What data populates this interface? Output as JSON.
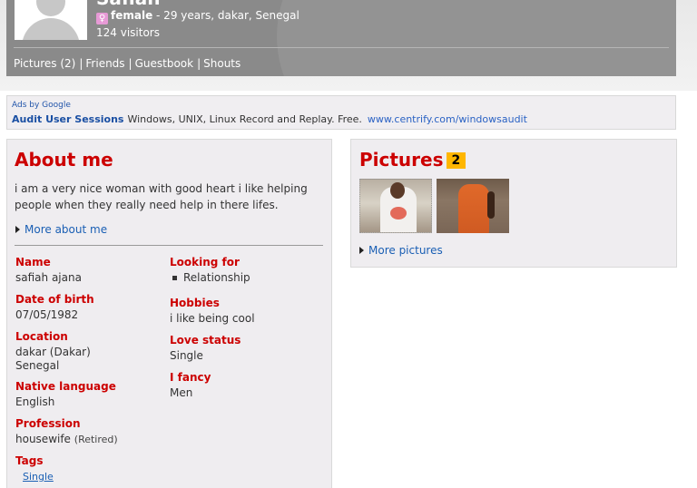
{
  "header": {
    "name_partial": "Safiah",
    "gender": "female",
    "details": " - 29 years, dakar, Senegal",
    "visitors": "124 visitors",
    "nav": [
      "Pictures (2)",
      "Friends",
      "Guestbook",
      "Shouts"
    ]
  },
  "ads": {
    "by_label": "Ads by Google",
    "title": "Audit User Sessions",
    "text": "Windows, UNIX, Linux  Record and Replay. Free.",
    "url": "www.centrify.com/windowsaudit"
  },
  "about": {
    "title": "About me",
    "bio": "i am a very nice woman with good heart i like helping people when they really need help in there lifes.",
    "more_label": "More about me",
    "fields": {
      "name": {
        "label": "Name",
        "value": "safiah ajana"
      },
      "dob": {
        "label": "Date of birth",
        "value": "07/05/1982"
      },
      "location": {
        "label": "Location",
        "value": "dakar (Dakar)",
        "value2": "Senegal"
      },
      "language": {
        "label": "Native language",
        "value": "English"
      },
      "profession": {
        "label": "Profession",
        "value": "housewife",
        "note": "(Retired)"
      },
      "tags": {
        "label": "Tags",
        "value": "Single"
      },
      "looking_for": {
        "label": "Looking for",
        "value": "Relationship"
      },
      "hobbies": {
        "label": "Hobbies",
        "value": "i like being cool"
      },
      "love_status": {
        "label": "Love status",
        "value": "Single"
      },
      "fancy": {
        "label": "I fancy",
        "value": "Men"
      }
    }
  },
  "pictures": {
    "title": "Pictures",
    "count": "2",
    "more_label": "More pictures"
  },
  "colors": {
    "accent_red": "#cc0000",
    "link_blue": "#1a5fb4",
    "badge_yellow": "#ffb600",
    "header_gray": "#8a8a8a"
  }
}
